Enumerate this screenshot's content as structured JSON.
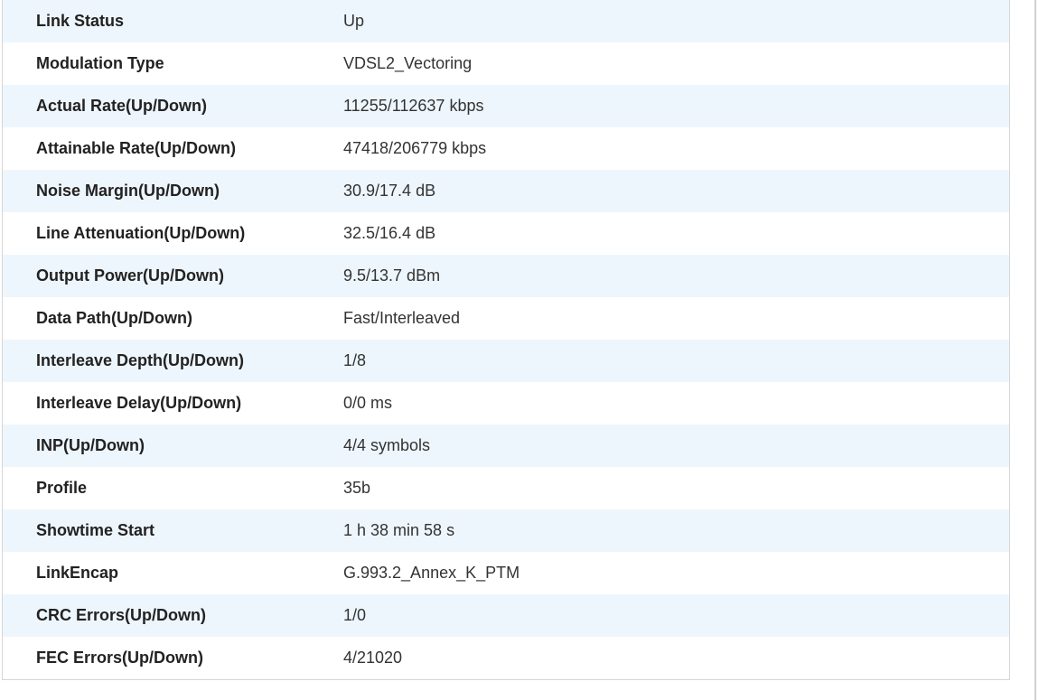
{
  "rows": [
    {
      "label": "Link Status",
      "value": "Up"
    },
    {
      "label": "Modulation Type",
      "value": "VDSL2_Vectoring"
    },
    {
      "label": "Actual Rate(Up/Down)",
      "value": "11255/112637 kbps"
    },
    {
      "label": "Attainable Rate(Up/Down)",
      "value": "47418/206779 kbps"
    },
    {
      "label": "Noise Margin(Up/Down)",
      "value": "30.9/17.4 dB"
    },
    {
      "label": "Line Attenuation(Up/Down)",
      "value": "32.5/16.4 dB"
    },
    {
      "label": "Output Power(Up/Down)",
      "value": "9.5/13.7 dBm"
    },
    {
      "label": "Data Path(Up/Down)",
      "value": "Fast/Interleaved"
    },
    {
      "label": "Interleave Depth(Up/Down)",
      "value": "1/8"
    },
    {
      "label": "Interleave Delay(Up/Down)",
      "value": "0/0 ms"
    },
    {
      "label": "INP(Up/Down)",
      "value": "4/4 symbols"
    },
    {
      "label": "Profile",
      "value": "35b"
    },
    {
      "label": "Showtime Start",
      "value": "1 h 38 min 58 s"
    },
    {
      "label": "LinkEncap",
      "value": "G.993.2_Annex_K_PTM"
    },
    {
      "label": "CRC Errors(Up/Down)",
      "value": "1/0"
    },
    {
      "label": "FEC Errors(Up/Down)",
      "value": "4/21020"
    }
  ],
  "colors": {
    "row_alt": "#eef6fd",
    "row_plain": "#ffffff",
    "border": "#d6d6d6"
  }
}
